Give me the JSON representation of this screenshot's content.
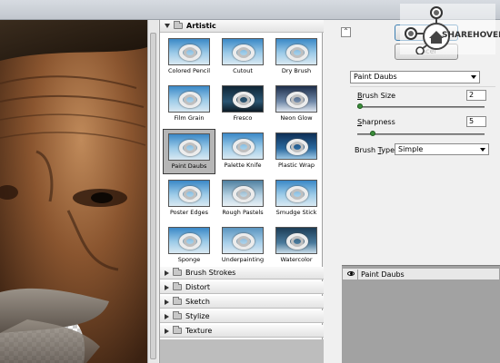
{
  "gallery": {
    "artistic_label": "Artistic",
    "filters": [
      {
        "name": "Colored Pencil",
        "bg": "#2f6f9c"
      },
      {
        "name": "Cutout",
        "bg": "#3f86b7"
      },
      {
        "name": "Dry Brush",
        "bg": "#3d7eaf"
      },
      {
        "name": "Film Grain",
        "bg": "#5c8ba3"
      },
      {
        "name": "Fresco",
        "bg": "#1b3c50"
      },
      {
        "name": "Neon Glow",
        "bg": "#3d5a78"
      },
      {
        "name": "Paint Daubs",
        "bg": "#4a86b4"
      },
      {
        "name": "Palette Knife",
        "bg": "#3783bb"
      },
      {
        "name": "Plastic Wrap",
        "bg": "#1c4f80"
      },
      {
        "name": "Poster Edges",
        "bg": "#2a6e9c"
      },
      {
        "name": "Rough Pastels",
        "bg": "#5a8fae"
      },
      {
        "name": "Smudge Stick",
        "bg": "#4c87a9"
      },
      {
        "name": "Sponge",
        "bg": "#3a7aaa"
      },
      {
        "name": "Underpainting",
        "bg": "#6da7cd"
      },
      {
        "name": "Watercolor",
        "bg": "#2d5d7e"
      }
    ],
    "selected": "Paint Daubs",
    "categories": [
      "Brush Strokes",
      "Distort",
      "Sketch",
      "Stylize",
      "Texture"
    ]
  },
  "controls": {
    "filter_select": "Paint Daubs",
    "brush_size_label_u": "B",
    "brush_size_label_rest": "rush Size",
    "brush_size_value": "2",
    "brush_size_level": 0.02,
    "sharpness_label_u": "S",
    "sharpness_label_rest": "harpness",
    "sharpness_value": "5",
    "sharpness_level": 0.12,
    "brush_type_label_pre": "Brush ",
    "brush_type_label_u": "T",
    "brush_type_label_rest": "ype:",
    "brush_type_value": "Simple",
    "collapse_symbol": "⌃",
    "cancel_label": "ancel"
  },
  "layers": {
    "layer_name": "Paint Daubs"
  },
  "logo": {
    "word": "SHAREHOVEL"
  }
}
